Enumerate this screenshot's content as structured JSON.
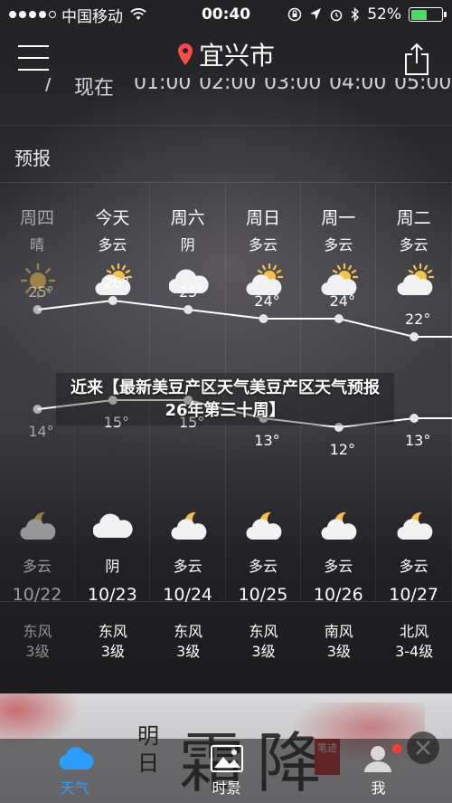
{
  "status_bar": {
    "carrier": "中国移动",
    "time": "00:40",
    "battery": "52%",
    "battery_level": 0.52,
    "battery_color": "#4cd964"
  },
  "header": {
    "city": "宜兴市",
    "icons": {
      "menu": "menu-icon",
      "location": "location-pin-icon",
      "share": "share-icon"
    },
    "pin_color": "#ff4a4a"
  },
  "aqi_strip": {
    "label": "现在",
    "times": [
      "01:00",
      "02:00",
      "03:00",
      "04:00",
      "05:00"
    ]
  },
  "forecast": {
    "title": "预报",
    "days": [
      {
        "day": "周四",
        "cond_day": "晴",
        "icon_day": "sun-icon",
        "high": "25°",
        "low": "14°",
        "cond_night": "多云",
        "icon_night": "moon-cloud-icon",
        "date": "10/22",
        "wind_dir": "东风",
        "wind_level": "3级",
        "past": true
      },
      {
        "day": "今天",
        "cond_day": "多云",
        "icon_day": "partly-cloudy-icon",
        "high": "26°",
        "low": "15°",
        "cond_night": "阴",
        "icon_night": "cloud-icon",
        "date": "10/23",
        "wind_dir": "东风",
        "wind_level": "3级",
        "past": false
      },
      {
        "day": "周六",
        "cond_day": "阴",
        "icon_day": "cloud-icon",
        "high": "25°",
        "low": "15°",
        "cond_night": "多云",
        "icon_night": "moon-cloud-icon",
        "date": "10/24",
        "wind_dir": "东风",
        "wind_level": "3级",
        "past": false
      },
      {
        "day": "周日",
        "cond_day": "多云",
        "icon_day": "partly-cloudy-icon",
        "high": "24°",
        "low": "13°",
        "cond_night": "多云",
        "icon_night": "moon-cloud-icon",
        "date": "10/25",
        "wind_dir": "东风",
        "wind_level": "3级",
        "past": false
      },
      {
        "day": "周一",
        "cond_day": "多云",
        "icon_day": "partly-cloudy-icon",
        "high": "24°",
        "low": "12°",
        "cond_night": "多云",
        "icon_night": "moon-cloud-icon",
        "date": "10/26",
        "wind_dir": "南风",
        "wind_level": "3级",
        "past": false
      },
      {
        "day": "周二",
        "cond_day": "多云",
        "icon_day": "partly-cloudy-icon",
        "high": "22°",
        "low": "13°",
        "cond_night": "多云",
        "icon_night": "moon-cloud-icon",
        "date": "10/27",
        "wind_dir": "北风",
        "wind_level": "3-4级",
        "past": false
      }
    ]
  },
  "chart_data": {
    "type": "line",
    "categories": [
      "10/22",
      "10/23",
      "10/24",
      "10/25",
      "10/26",
      "10/27"
    ],
    "series": [
      {
        "values": [
          25,
          26,
          25,
          24,
          24,
          22
        ]
      },
      {
        "values": [
          14,
          15,
          15,
          13,
          12,
          13
        ]
      }
    ],
    "ylim": [
      10,
      28
    ]
  },
  "banner": {
    "small_text": "明日",
    "big_text": "霜降",
    "seal_text": "笔迹"
  },
  "overlay_caption": "近来【最新美豆产区天气美豆产区天气预报26年第三十周】",
  "tabbar": {
    "tabs": [
      {
        "label": "天气",
        "icon": "cloud-tab-icon",
        "active": true
      },
      {
        "label": "时景",
        "icon": "photo-icon",
        "active": false
      },
      {
        "label": "",
        "icon": "",
        "active": false
      },
      {
        "label": "我",
        "icon": "user-icon",
        "active": false
      }
    ],
    "active_color": "#2d9cff"
  }
}
